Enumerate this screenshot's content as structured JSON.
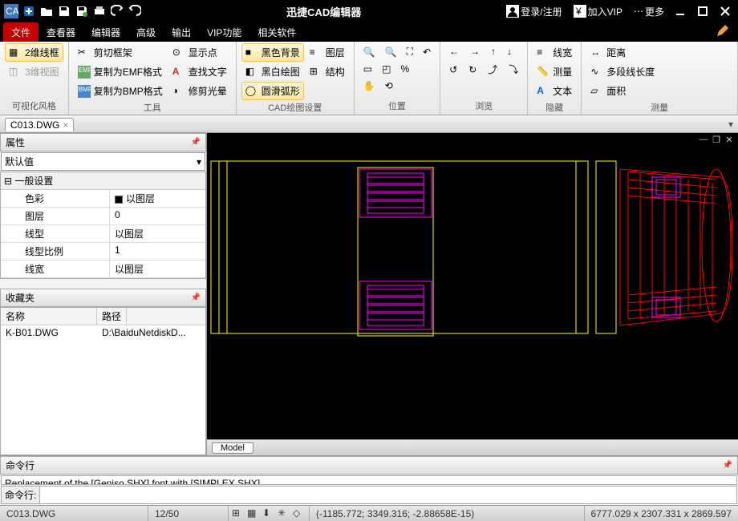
{
  "title": "迅捷CAD编辑器",
  "titlebar_right": {
    "login": "登录/注册",
    "vip": "加入VIP",
    "more": "更多"
  },
  "menus": [
    "文件",
    "查看器",
    "编辑器",
    "高级",
    "输出",
    "VIP功能",
    "相关软件"
  ],
  "active_menu": 0,
  "ribbon": {
    "g1": {
      "title": "可视化风格",
      "b1": "2维线框",
      "b2": "3维视图"
    },
    "g2": {
      "title": "工具",
      "b1": "剪切框架",
      "b2": "复制为EMF格式",
      "b3": "复制为BMP格式",
      "b4": "显示点",
      "b5": "查找文字",
      "b6": "修剪光晕"
    },
    "g3": {
      "title": "CAD绘图设置",
      "b1": "黑色背景",
      "b2": "黑白绘图",
      "b3": "圆滑弧形",
      "b4": "图层",
      "b5": "结构"
    },
    "g4": {
      "title": "位置"
    },
    "g5": {
      "title": "浏览"
    },
    "g6": {
      "title": "隐藏",
      "b1": "线宽",
      "b2": "测量",
      "b3": "文本"
    },
    "g7": {
      "title": "测量",
      "b1": "距离",
      "b2": "多段线长度",
      "b3": "面积"
    }
  },
  "doc_tab": "C013.DWG",
  "props": {
    "hdr": "属性",
    "combo": "默认值",
    "group": "一般设置",
    "rows": [
      {
        "k": "色彩",
        "v": "以图层",
        "sq": true
      },
      {
        "k": "图层",
        "v": "0"
      },
      {
        "k": "线型",
        "v": "以图层"
      },
      {
        "k": "线型比例",
        "v": "1"
      },
      {
        "k": "线宽",
        "v": "以图层"
      }
    ]
  },
  "fav": {
    "hdr": "收藏夹",
    "col1": "名称",
    "col2": "路径",
    "r1c1": "K-B01.DWG",
    "r1c2": "D:\\BaiduNetdiskD..."
  },
  "model_tab": "Model",
  "cmd": {
    "hdr": "命令行",
    "out": "Replacement of the [Geniso.SHX] font with [SIMPLEX.SHX]",
    "label": "命令行:"
  },
  "status": {
    "file": "C013.DWG",
    "pg": "12/50",
    "coords": "(-1185.772; 3349.316; -2.88658E-15)",
    "dims": "6777.029 x 2307.331 x 2869.597"
  }
}
